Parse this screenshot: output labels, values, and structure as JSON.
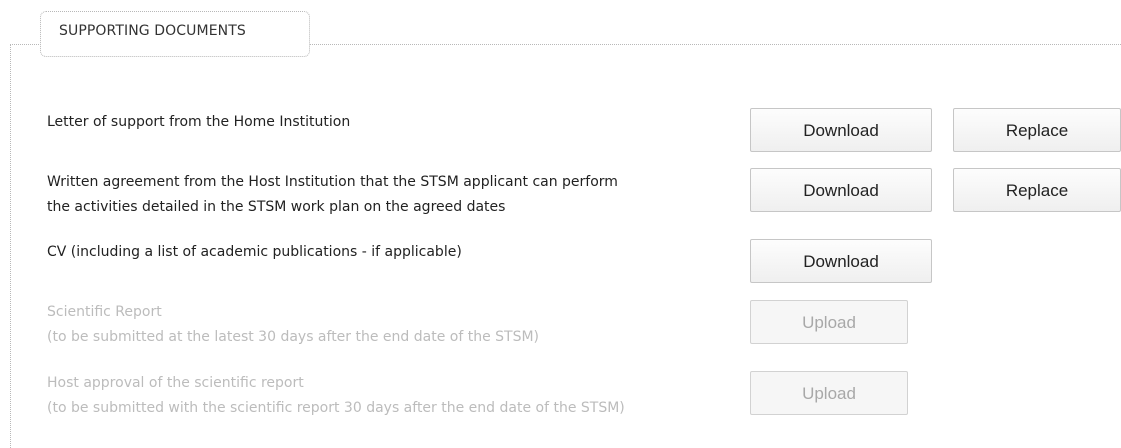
{
  "section": {
    "title": "SUPPORTING DOCUMENTS"
  },
  "documents": [
    {
      "lines": [
        "Letter of support from the Home Institution"
      ],
      "download_label": "Download",
      "replace_label": "Replace"
    },
    {
      "lines": [
        "Written agreement from the Host Institution that the STSM applicant can perform",
        "the activities detailed in the STSM work plan on the agreed dates"
      ],
      "download_label": "Download",
      "replace_label": "Replace"
    },
    {
      "lines": [
        "CV (including a list of academic publications - if applicable)"
      ],
      "download_label": "Download"
    },
    {
      "lines": [
        "Scientific Report",
        "(to be submitted at the latest 30 days after the end date of the STSM)"
      ],
      "upload_label": "Upload",
      "disabled": true
    },
    {
      "lines": [
        "Host approval of the scientific report",
        "(to be submitted with the scientific report 30 days after the end date of the STSM)"
      ],
      "upload_label": "Upload",
      "disabled": true
    }
  ]
}
